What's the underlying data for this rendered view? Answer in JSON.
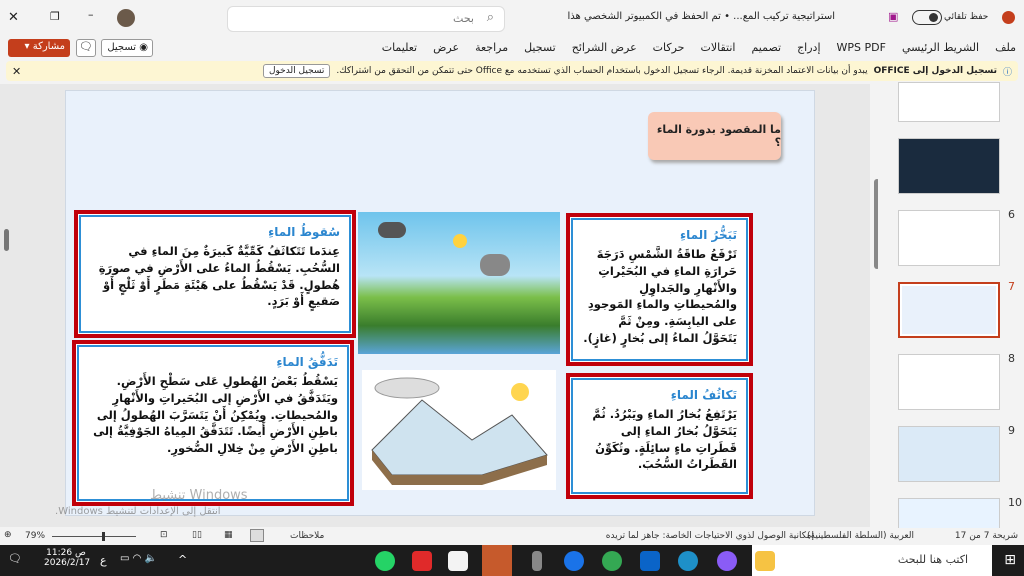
{
  "window": {
    "title": "استراتيجية تركيب المع... • تم الحفظ في الكمبيوتر الشخصي هذا",
    "autosave_label": "حفظ تلقائي",
    "search_placeholder": "بحث"
  },
  "ribbon": {
    "tabs": [
      "ملف",
      "الشريط الرئيسي",
      "WPS PDF",
      "إدراج",
      "تصميم",
      "انتقالات",
      "حركات",
      "عرض الشرائح",
      "تسجيل",
      "مراجعة",
      "عرض",
      "تعليمات"
    ],
    "record_label": "تسجيل",
    "share_label": "مشاركة"
  },
  "notification": {
    "title": "تسجيل الدخول إلى OFFICE",
    "message": "يبدو أن بيانات الاعتماد المخزنة قديمة. الرجاء تسجيل الدخول باستخدام الحساب الذي تستخدمه مع Office حتى تتمكن من التحقق من اشتراكك.",
    "button": "تسجيل الدخول"
  },
  "slide": {
    "title": "ما المقصود بدورة الماء ؟",
    "boxes": [
      {
        "heading": "تَبَخُّرُ الماءِ",
        "text": "تَرْفَعُ طاقَةُ الشَّمْسِ دَرَجَةَ حَرارَةِ الماءِ في البُحَيْراتِ والأَنْهارِ والجَداوِلِ والمُحيطاتِ والماءِ المَوجودِ على اليابِسَةِ. ومِنْ ثَمَّ يَتَحَوَّلُ الماءُ إلى بُخارٍ (غازٍ)."
      },
      {
        "heading": "تَكاثُفُ الماءِ",
        "text": "يَرْتَفِعُ بُخارُ الماءِ ويَبْرُدُ. ثُمَّ يَتَحَوَّلُ بُخارُ الماءِ إلى قَطَراتِ ماءٍ سائِلَةٍ. وتُكَوِّنُ القَطَراتُ السُّحُبَ."
      },
      {
        "heading": "سُقوطُ الماءِ",
        "text": "عِندَما تَتَكاثَفُ كَمِّيَّةٌ كَبيرَةٌ مِنَ الماءِ في السُّحُبِ. يَسْقُطُ الماءُ على الأَرْضِ في صورَةِ هُطولٍ. قَدْ يَسْقُطُ على هَيْئَةِ مَطَرٍ أَوْ ثَلْجٍ أَوْ صَقيعٍ أَوْ بَرَدٍ."
      },
      {
        "heading": "تَدَفُّقُ الماءِ",
        "text": "يَسْقُطُ بَعْضُ الهُطولِ عَلى سَطْحِ الأَرْضِ. ويَتَدَفَّقُ في الأَرْضِ إلى البُحَيراتِ والأَنْهارِ والمُحيطاتِ. ويُمْكِنُ أَنْ يَتَسَرَّبَ الهُطولُ إلى باطِنِ الأَرْضِ أَيضًا. تَتَدَفَّقُ المِياهُ الجَوْفِيَّةُ إلى باطِنِ الأَرْضِ مِنْ خِلالِ الصُّخورِ."
      }
    ]
  },
  "watermark": {
    "line1": "تنشيط Windows",
    "line2": "انتقل إلى الإعدادات لتنشيط Windows."
  },
  "thumbnails": {
    "numbers": [
      "6",
      "7",
      "8",
      "9",
      "10"
    ],
    "selected": "7"
  },
  "status": {
    "slide_of": "شريحة 7 من 17",
    "language": "العربية (السلطة الفلسطينية)",
    "accessibility": "إمكانية الوصول لذوي الاحتياجات الخاصة: جاهز لما تريده",
    "notes": "ملاحظات",
    "zoom": "79%"
  },
  "taskbar": {
    "search_placeholder": "اكتب هنا للبحث",
    "time": "11:26 ص",
    "date": "2026/2/17",
    "lang": "ع"
  },
  "colors": {
    "accent": "#c43e1c",
    "box_border": "#c0000b",
    "heading": "#2b86cf"
  }
}
